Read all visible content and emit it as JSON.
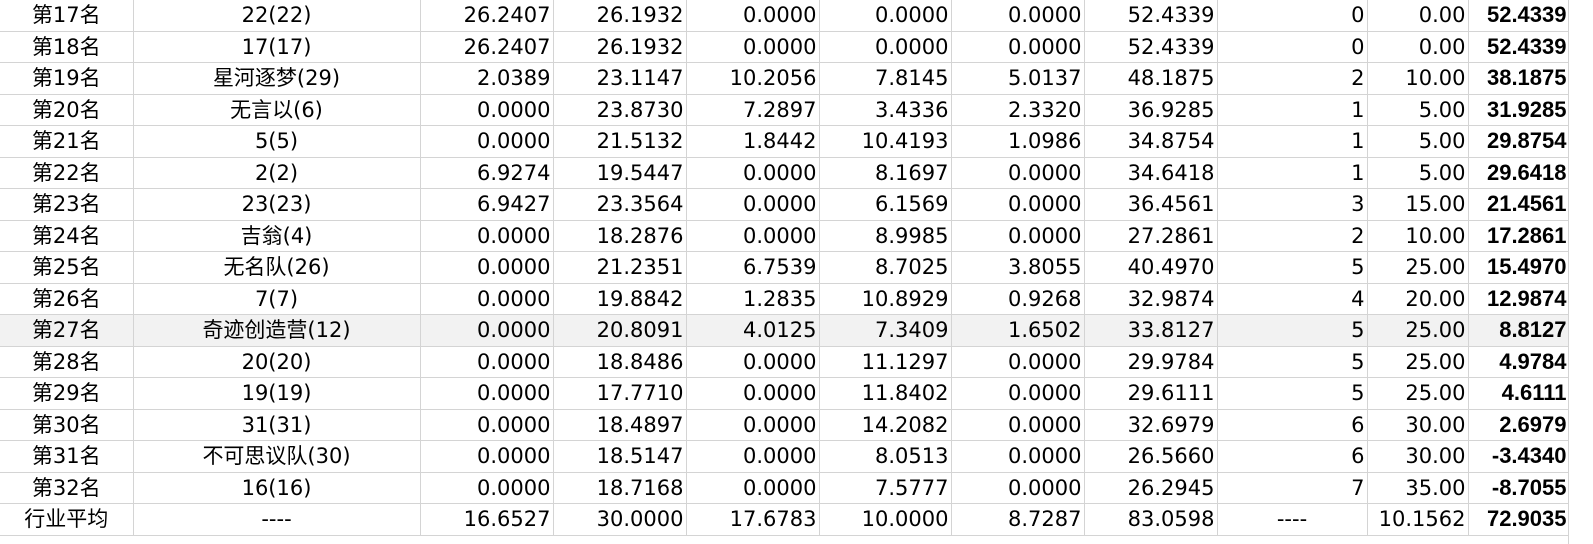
{
  "rows": [
    {
      "rank": "第17名",
      "team": "22(22)",
      "v1": "26.2407",
      "v2": "26.1932",
      "v3": "0.0000",
      "v4": "0.0000",
      "v5": "0.0000",
      "v6": "52.4339",
      "n": "0",
      "p": "0.00",
      "total": "52.4339"
    },
    {
      "rank": "第18名",
      "team": "17(17)",
      "v1": "26.2407",
      "v2": "26.1932",
      "v3": "0.0000",
      "v4": "0.0000",
      "v5": "0.0000",
      "v6": "52.4339",
      "n": "0",
      "p": "0.00",
      "total": "52.4339"
    },
    {
      "rank": "第19名",
      "team": "星河逐梦(29)",
      "v1": "2.0389",
      "v2": "23.1147",
      "v3": "10.2056",
      "v4": "7.8145",
      "v5": "5.0137",
      "v6": "48.1875",
      "n": "2",
      "p": "10.00",
      "total": "38.1875"
    },
    {
      "rank": "第20名",
      "team": "无言以(6)",
      "v1": "0.0000",
      "v2": "23.8730",
      "v3": "7.2897",
      "v4": "3.4336",
      "v5": "2.3320",
      "v6": "36.9285",
      "n": "1",
      "p": "5.00",
      "total": "31.9285"
    },
    {
      "rank": "第21名",
      "team": "5(5)",
      "v1": "0.0000",
      "v2": "21.5132",
      "v3": "1.8442",
      "v4": "10.4193",
      "v5": "1.0986",
      "v6": "34.8754",
      "n": "1",
      "p": "5.00",
      "total": "29.8754"
    },
    {
      "rank": "第22名",
      "team": "2(2)",
      "v1": "6.9274",
      "v2": "19.5447",
      "v3": "0.0000",
      "v4": "8.1697",
      "v5": "0.0000",
      "v6": "34.6418",
      "n": "1",
      "p": "5.00",
      "total": "29.6418"
    },
    {
      "rank": "第23名",
      "team": "23(23)",
      "v1": "6.9427",
      "v2": "23.3564",
      "v3": "0.0000",
      "v4": "6.1569",
      "v5": "0.0000",
      "v6": "36.4561",
      "n": "3",
      "p": "15.00",
      "total": "21.4561"
    },
    {
      "rank": "第24名",
      "team": "吉翁(4)",
      "v1": "0.0000",
      "v2": "18.2876",
      "v3": "0.0000",
      "v4": "8.9985",
      "v5": "0.0000",
      "v6": "27.2861",
      "n": "2",
      "p": "10.00",
      "total": "17.2861"
    },
    {
      "rank": "第25名",
      "team": "无名队(26)",
      "v1": "0.0000",
      "v2": "21.2351",
      "v3": "6.7539",
      "v4": "8.7025",
      "v5": "3.8055",
      "v6": "40.4970",
      "n": "5",
      "p": "25.00",
      "total": "15.4970"
    },
    {
      "rank": "第26名",
      "team": "7(7)",
      "v1": "0.0000",
      "v2": "19.8842",
      "v3": "1.2835",
      "v4": "10.8929",
      "v5": "0.9268",
      "v6": "32.9874",
      "n": "4",
      "p": "20.00",
      "total": "12.9874"
    },
    {
      "rank": "第27名",
      "team": "奇迹创造营(12)",
      "v1": "0.0000",
      "v2": "20.8091",
      "v3": "4.0125",
      "v4": "7.3409",
      "v5": "1.6502",
      "v6": "33.8127",
      "n": "5",
      "p": "25.00",
      "total": "8.8127"
    },
    {
      "rank": "第28名",
      "team": "20(20)",
      "v1": "0.0000",
      "v2": "18.8486",
      "v3": "0.0000",
      "v4": "11.1297",
      "v5": "0.0000",
      "v6": "29.9784",
      "n": "5",
      "p": "25.00",
      "total": "4.9784"
    },
    {
      "rank": "第29名",
      "team": "19(19)",
      "v1": "0.0000",
      "v2": "17.7710",
      "v3": "0.0000",
      "v4": "11.8402",
      "v5": "0.0000",
      "v6": "29.6111",
      "n": "5",
      "p": "25.00",
      "total": "4.6111"
    },
    {
      "rank": "第30名",
      "team": "31(31)",
      "v1": "0.0000",
      "v2": "18.4897",
      "v3": "0.0000",
      "v4": "14.2082",
      "v5": "0.0000",
      "v6": "32.6979",
      "n": "6",
      "p": "30.00",
      "total": "2.6979"
    },
    {
      "rank": "第31名",
      "team": "不可思议队(30)",
      "v1": "0.0000",
      "v2": "18.5147",
      "v3": "0.0000",
      "v4": "8.0513",
      "v5": "0.0000",
      "v6": "26.5660",
      "n": "6",
      "p": "30.00",
      "total": "-3.4340"
    },
    {
      "rank": "第32名",
      "team": "16(16)",
      "v1": "0.0000",
      "v2": "18.7168",
      "v3": "0.0000",
      "v4": "7.5777",
      "v5": "0.0000",
      "v6": "26.2945",
      "n": "7",
      "p": "35.00",
      "total": "-8.7055"
    },
    {
      "rank": "行业平均",
      "team": "----",
      "v1": "16.6527",
      "v2": "30.0000",
      "v3": "17.6783",
      "v4": "10.0000",
      "v5": "8.7287",
      "v6": "83.0598",
      "n": "----",
      "p": "10.1562",
      "total": "72.9035"
    }
  ],
  "highlight_row": 10,
  "colors": {
    "grid": "#d4d4d4",
    "highlight": "#f2f2f2"
  }
}
